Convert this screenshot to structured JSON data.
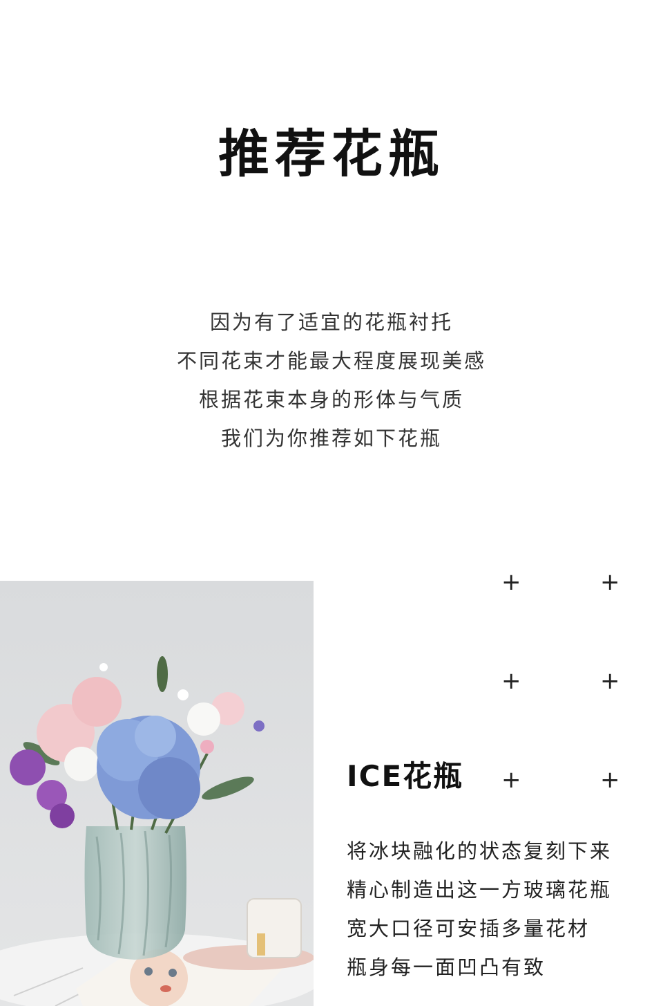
{
  "header": {
    "title": "推荐花瓶"
  },
  "intro": {
    "lines": [
      "因为有了适宜的花瓶衬托",
      "不同花束才能最大程度展现美感",
      "根据花束本身的形体与气质",
      "我们为你推荐如下花瓶"
    ]
  },
  "decor": {
    "plus_symbol": "+"
  },
  "product": {
    "name": "ICE花瓶",
    "description_lines": [
      "将冰块融化的状态复刻下来",
      "精心制造出这一方玻璃花瓶",
      "宽大口径可安插多量花材",
      "瓶身每一面凹凸有致"
    ]
  }
}
